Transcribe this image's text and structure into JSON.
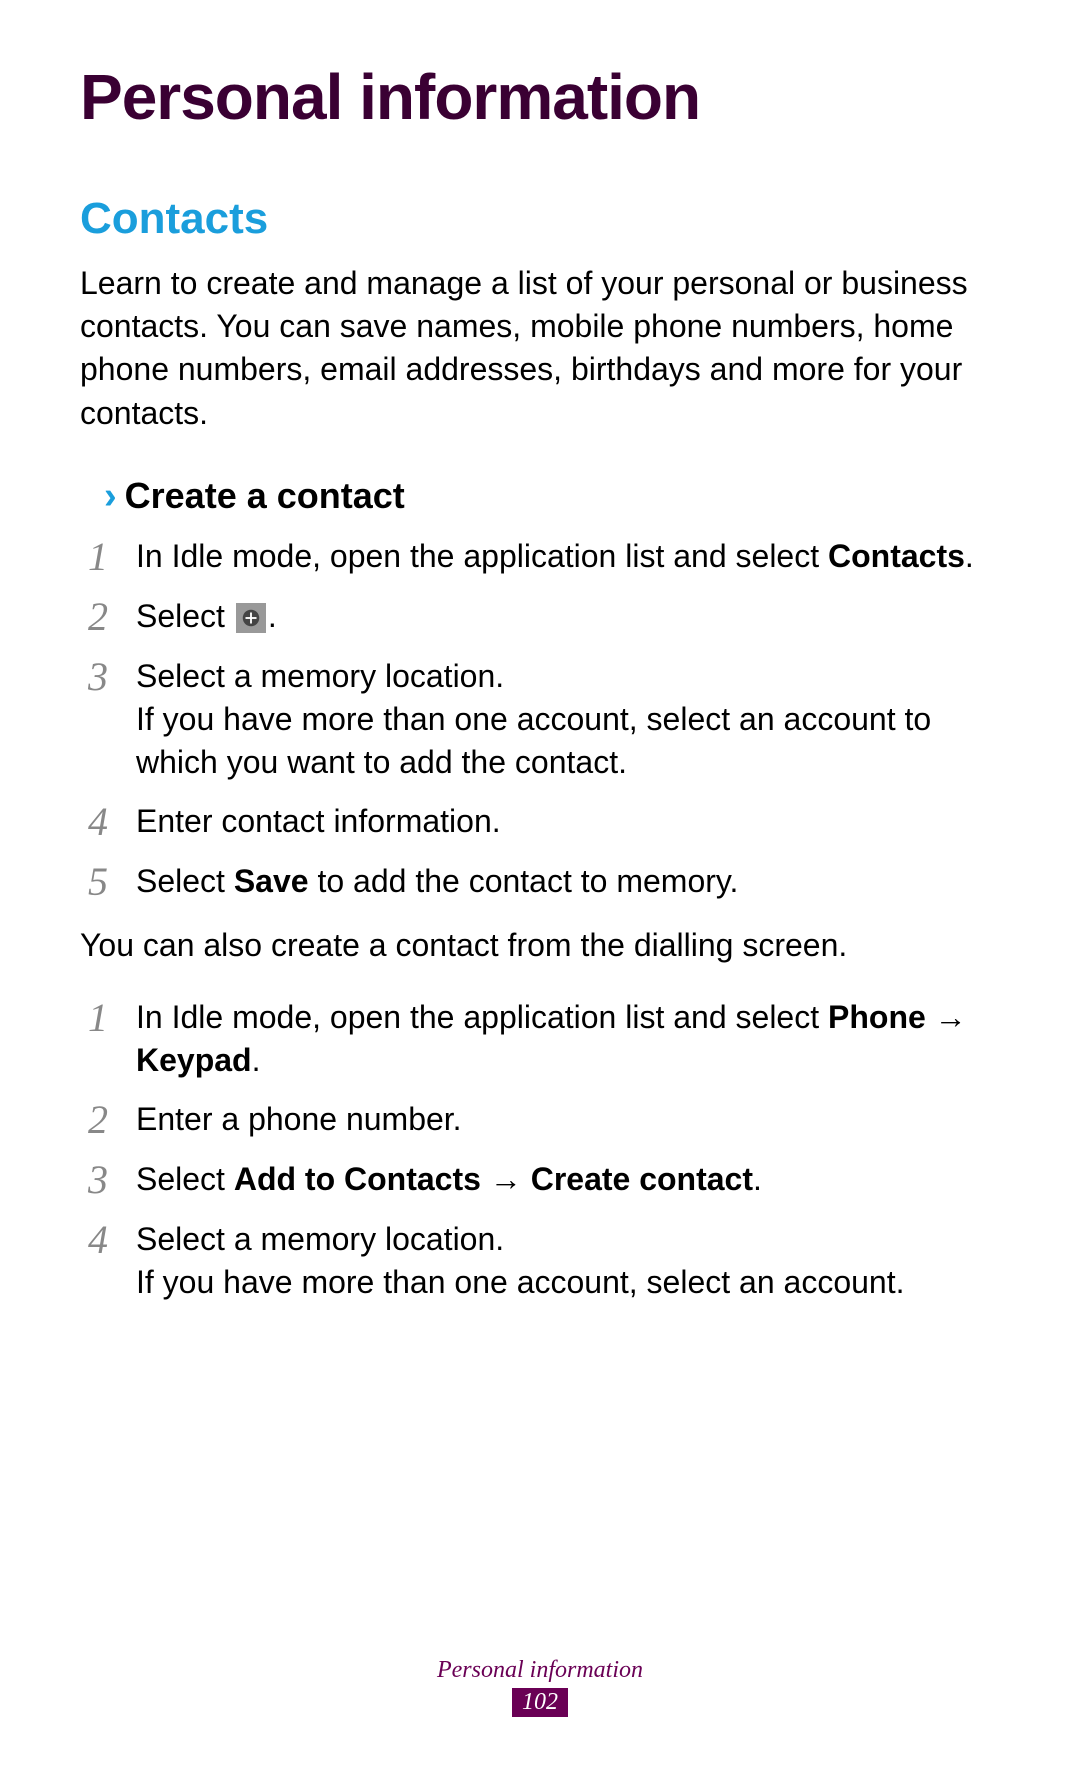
{
  "chapter_title": "Personal information",
  "section": {
    "title": "Contacts",
    "intro": "Learn to create and manage a list of your personal or business contacts. You can save names, mobile phone numbers, home phone numbers, email addresses, birthdays and more for your contacts."
  },
  "subsection": {
    "chevron": "›",
    "title": "Create a contact"
  },
  "stepsA": {
    "s1_pre": "In Idle mode, open the application list and select ",
    "s1_bold": "Contacts",
    "s1_post": ".",
    "s2_pre": "Select ",
    "s2_post": ".",
    "s3_line1": "Select a memory location.",
    "s3_line2": "If you have more than one account, select an account to which you want to add the contact.",
    "s4": "Enter contact information.",
    "s5_pre": "Select ",
    "s5_bold": "Save",
    "s5_post": " to add the contact to memory."
  },
  "note": "You can also create a contact from the dialling screen.",
  "stepsB": {
    "s1_pre": "In Idle mode, open the application list and select ",
    "s1_bold1": "Phone",
    "s1_arrow": " → ",
    "s1_bold2": "Keypad",
    "s1_post": ".",
    "s2": "Enter a phone number.",
    "s3_pre": "Select ",
    "s3_bold1": "Add to Contacts",
    "s3_arrow": " → ",
    "s3_bold2": "Create contact",
    "s3_post": ".",
    "s4_line1": "Select a memory location.",
    "s4_line2": "If you have more than one account, select an account."
  },
  "nums": {
    "n1": "1",
    "n2": "2",
    "n3": "3",
    "n4": "4",
    "n5": "5"
  },
  "footer": {
    "title": "Personal information",
    "page": "102"
  },
  "icons": {
    "plus": "plus-icon"
  }
}
